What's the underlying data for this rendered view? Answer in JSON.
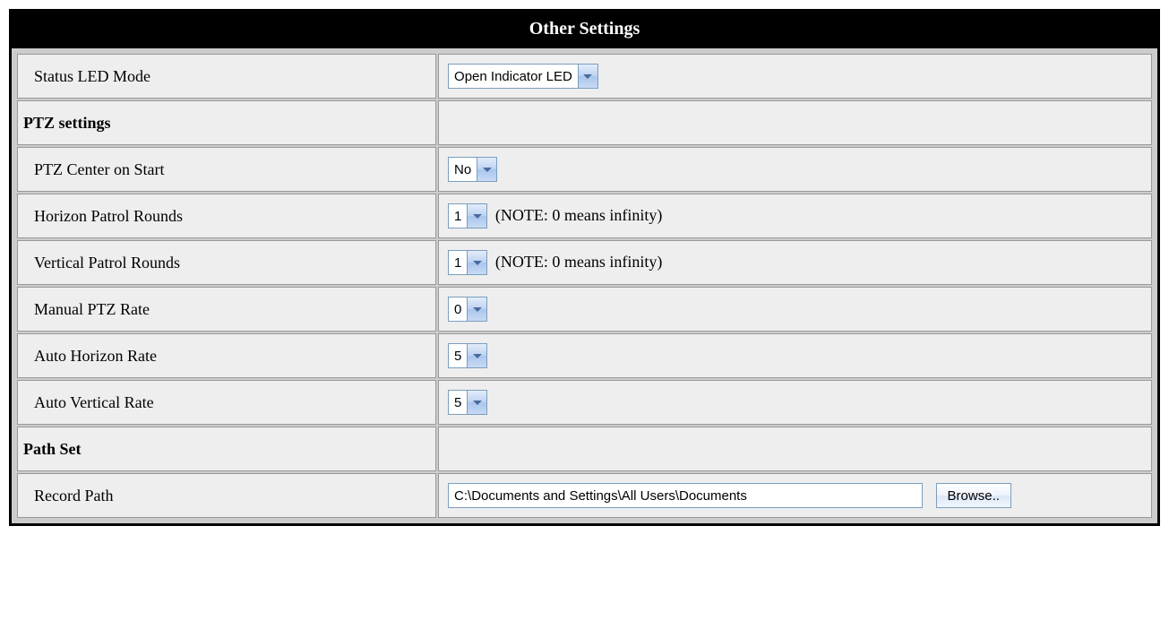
{
  "header": {
    "title": "Other Settings"
  },
  "rows": {
    "statusLed": {
      "label": "Status LED Mode",
      "value": "Open Indicator LED"
    },
    "ptzSection": {
      "heading": "PTZ settings"
    },
    "ptzCenter": {
      "label": "PTZ Center on Start",
      "value": "No"
    },
    "horizonPatrol": {
      "label": "Horizon Patrol Rounds",
      "value": "1",
      "note": "(NOTE: 0 means infinity)"
    },
    "verticalPatrol": {
      "label": "Vertical Patrol Rounds",
      "value": "1",
      "note": "(NOTE: 0 means infinity)"
    },
    "manualPtzRate": {
      "label": "Manual PTZ Rate",
      "value": "0"
    },
    "autoHorizonRate": {
      "label": "Auto Horizon Rate",
      "value": "5"
    },
    "autoVerticalRate": {
      "label": "Auto Vertical Rate",
      "value": "5"
    },
    "pathSection": {
      "heading": "Path Set"
    },
    "recordPath": {
      "label": "Record Path",
      "value": "C:\\Documents and Settings\\All Users\\Documents",
      "browseLabel": "Browse.."
    }
  }
}
